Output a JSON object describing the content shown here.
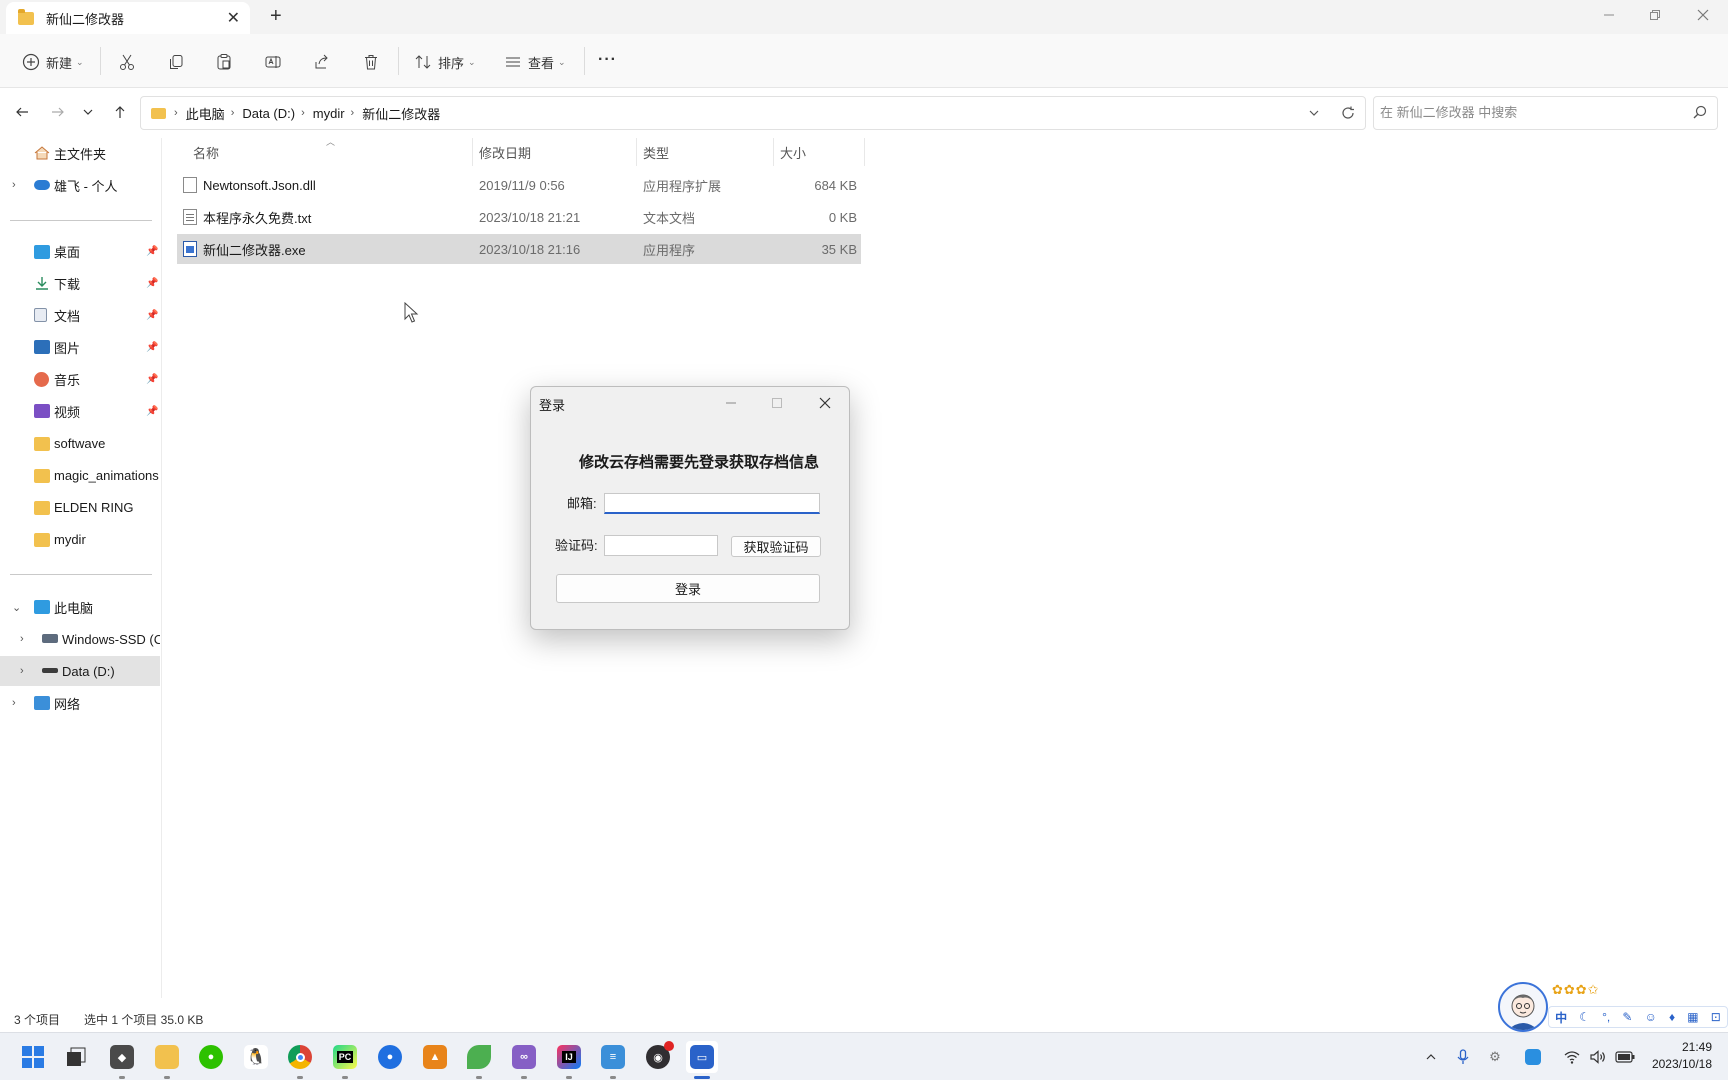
{
  "window": {
    "tab_title": "新仙二修改器",
    "accent": "#2a62c9"
  },
  "toolbar": {
    "new_label": "新建",
    "sort_label": "排序",
    "view_label": "查看",
    "more_label": "···"
  },
  "address": {
    "crumbs": [
      "此电脑",
      "Data (D:)",
      "mydir",
      "新仙二修改器"
    ],
    "sep": "›"
  },
  "search": {
    "placeholder": "在 新仙二修改器 中搜索"
  },
  "sidebar": {
    "home": "主文件夹",
    "onedrive": "雄飞 - 个人",
    "quick": [
      "桌面",
      "下载",
      "文档",
      "图片",
      "音乐",
      "视频",
      "softwave",
      "magic_animations",
      "ELDEN RING",
      "mydir"
    ],
    "this_pc": "此电脑",
    "drives": [
      "Windows-SSD (C",
      "Data (D:)"
    ],
    "network": "网络"
  },
  "columns": {
    "name": "名称",
    "date": "修改日期",
    "type": "类型",
    "size": "大小"
  },
  "files": [
    {
      "name": "Newtonsoft.Json.dll",
      "date": "2019/11/9 0:56",
      "type": "应用程序扩展",
      "size": "684 KB",
      "icon": "dll-file-icon"
    },
    {
      "name": "本程序永久免费.txt",
      "date": "2023/10/18 21:21",
      "type": "文本文档",
      "size": "0 KB",
      "icon": "text-file-icon"
    },
    {
      "name": "新仙二修改器.exe",
      "date": "2023/10/18 21:16",
      "type": "应用程序",
      "size": "35 KB",
      "icon": "exe-file-icon",
      "selected": true
    }
  ],
  "status": {
    "count": "3 个项目",
    "selection": "选中 1 个项目 35.0 KB"
  },
  "dialog": {
    "title": "登录",
    "heading": "修改云存档需要先登录获取存档信息",
    "email_label": "邮箱:",
    "email_value": "",
    "code_label": "验证码:",
    "code_value": "",
    "get_code_button": "获取验证码",
    "login_button": "登录"
  },
  "ime": {
    "stars": "✿✿✿✩",
    "mode": "中"
  },
  "taskbar": {
    "time": "21:49",
    "date": "2023/10/18"
  }
}
